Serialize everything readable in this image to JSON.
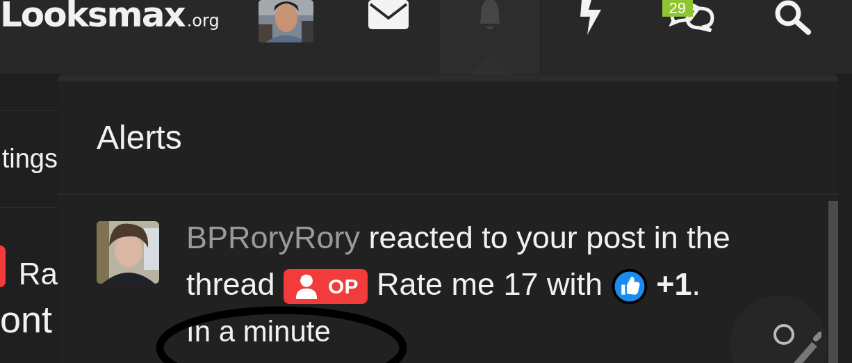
{
  "header": {
    "logo": "Looksmax",
    "logo_suffix": ".org",
    "nav": [
      {
        "kind": "mail",
        "selected": false
      },
      {
        "kind": "bell",
        "selected": true
      },
      {
        "kind": "bolt",
        "selected": false
      },
      {
        "kind": "chat",
        "selected": false,
        "badge": "29"
      },
      {
        "kind": "search",
        "selected": false
      }
    ]
  },
  "background_page": {
    "texts": [
      "tings",
      "Ra",
      "ont"
    ]
  },
  "alerts_menu": {
    "title": "Alerts",
    "alerts": [
      {
        "user": "BPRoryRory",
        "text_before": "reacted to your post in the thread",
        "prefix": "OP",
        "thread_title": "Rate me 17 with",
        "reaction": "+1",
        "end": ".",
        "time": "In a minute"
      }
    ]
  }
}
